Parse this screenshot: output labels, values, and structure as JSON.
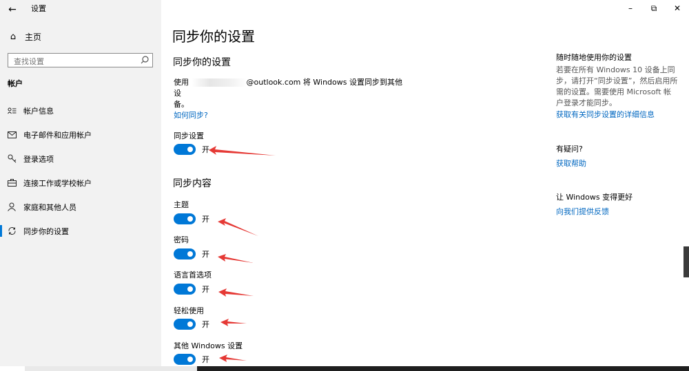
{
  "app_title": "设置",
  "sidebar": {
    "home_label": "主页",
    "search": {
      "placeholder": "查找设置",
      "value": ""
    },
    "section": "帐户",
    "items": [
      {
        "label": "帐户信息",
        "icon": "person-card-icon"
      },
      {
        "label": "电子邮件和应用帐户",
        "icon": "mail-icon"
      },
      {
        "label": "登录选项",
        "icon": "key-icon"
      },
      {
        "label": "连接工作或学校帐户",
        "icon": "briefcase-icon"
      },
      {
        "label": "家庭和其他人员",
        "icon": "person-icon"
      },
      {
        "label": "同步你的设置",
        "icon": "sync-icon",
        "active": true
      }
    ]
  },
  "main": {
    "page_title": "同步你的设置",
    "section_title": "同步你的设置",
    "desc_prefix": "使用",
    "desc_suffix": "@outlook.com 将 Windows 设置同步到其他设",
    "desc_line2": "备。",
    "how_link": "如何同步?",
    "sync_settings_label": "同步设置",
    "sync_settings_state": "开",
    "content_title": "同步内容",
    "toggles": [
      {
        "label": "主题",
        "state": "开"
      },
      {
        "label": "密码",
        "state": "开"
      },
      {
        "label": "语言首选项",
        "state": "开"
      },
      {
        "label": "轻松使用",
        "state": "开"
      },
      {
        "label": "其他 Windows 设置",
        "state": "开"
      }
    ]
  },
  "right": {
    "heading1": "随时随地使用你的设置",
    "text1": "若要在所有 Windows 10 设备上同步，请打开“同步设置”，然后启用所需的设置。需要使用 Microsoft 帐户登录才能同步。",
    "link1": "获取有关同步设置的详细信息",
    "heading2": "有疑问?",
    "link2": "获取帮助",
    "heading3": "让 Windows 变得更好",
    "link3": "向我们提供反馈"
  },
  "colors": {
    "accent": "#0078d7",
    "link": "#0067c0",
    "annotation": "#e53935"
  }
}
